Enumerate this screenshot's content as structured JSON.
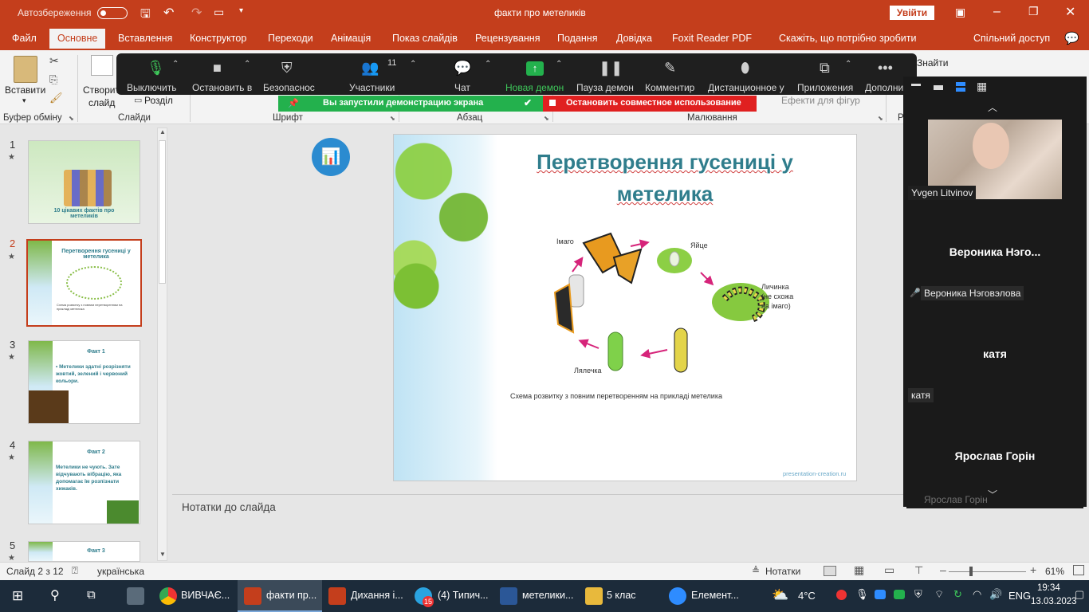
{
  "titlebar": {
    "autosave": "Автозбереження",
    "doc_title": "факти про метеликів",
    "signin": "Увійти"
  },
  "tabs": [
    "Файл",
    "Основне",
    "Вставлення",
    "Конструктор",
    "Переходи",
    "Анімація",
    "Показ слайдів",
    "Рецензування",
    "Подання",
    "Довідка",
    "Foxit Reader PDF",
    "Скажіть, що потрібно зробити",
    "Спільний доступ"
  ],
  "ribbon": {
    "paste": "Вставити",
    "create_slide": "Створити",
    "slide": "слайд",
    "section": "Розділ",
    "clipboard": "Буфер обміну",
    "slides": "Слайди",
    "font": "Шрифт",
    "paragraph": "Абзац",
    "drawing": "Малювання",
    "shape_effects": "Ефекти для фігур",
    "find": "Знайти",
    "r_label": "Р"
  },
  "zoom": {
    "mute": "Выключить",
    "stop_video": "Остановить в",
    "security": "Безопаснос",
    "participants": "Участники",
    "participants_count": "11",
    "chat": "Чат",
    "new_share": "Новая демон",
    "pause_share": "Пауза демон",
    "annotate": "Комментир",
    "remote": "Дистанционное у",
    "apps": "Приложения",
    "more": "Дополни",
    "share_msg": "Вы запустили демонстрацию экрана",
    "stop_share": "Остановить совместное использование"
  },
  "thumbs": [
    {
      "num": "1",
      "title": "10 цікавих фактів про метеликів"
    },
    {
      "num": "2",
      "title": "Перетворення гусениці у метелика",
      "caption": "Схема розвитку з повним перетворенням на прикладі метелика"
    },
    {
      "num": "3",
      "title": "Факт 1",
      "text": "• Метелики здатні розрізняти жовтий, зелений і червоний кольори."
    },
    {
      "num": "4",
      "title": "Факт 2",
      "text": "Метелики не чують. Зате відчувають вібрацію, яка допомагає їм розпізнати хижаків."
    },
    {
      "num": "5",
      "title": "Факт 3"
    }
  ],
  "slide": {
    "title": "Перетворення гусениці у метелика",
    "labels": {
      "imago": "Імаго",
      "egg": "Яйце",
      "larva": "Личинка\n(не схожа\nна імаго)",
      "pupa": "Лялечка"
    },
    "caption": "Схема розвитку з повним перетворенням на прикладі метелика",
    "watermark": "presentation-creation.ru"
  },
  "notes_placeholder": "Нотатки до слайда",
  "participants": [
    {
      "name": "Yvgen Litvinov",
      "video": true
    },
    {
      "name": "Вероника  Нэго...",
      "label": "Вероника Нэговэлова",
      "muted": true
    },
    {
      "name": "катя",
      "label": "катя"
    },
    {
      "name": "Ярослав Горін",
      "label": "Ярослав Горін"
    }
  ],
  "status": {
    "slide_of": "Слайд 2 з 12",
    "language": "українська",
    "notes": "Нотатки",
    "zoom_level": "61%"
  },
  "taskbar": {
    "items": [
      "ВИВЧАЄ...",
      "факти пр...",
      "Дихання і...",
      "(4) Типич...",
      "метелики...",
      "5 клас",
      "Елемент..."
    ],
    "badge": "15",
    "weather": "4°C",
    "lang": "ENG",
    "time": "19:34",
    "date": "13.03.2023"
  }
}
